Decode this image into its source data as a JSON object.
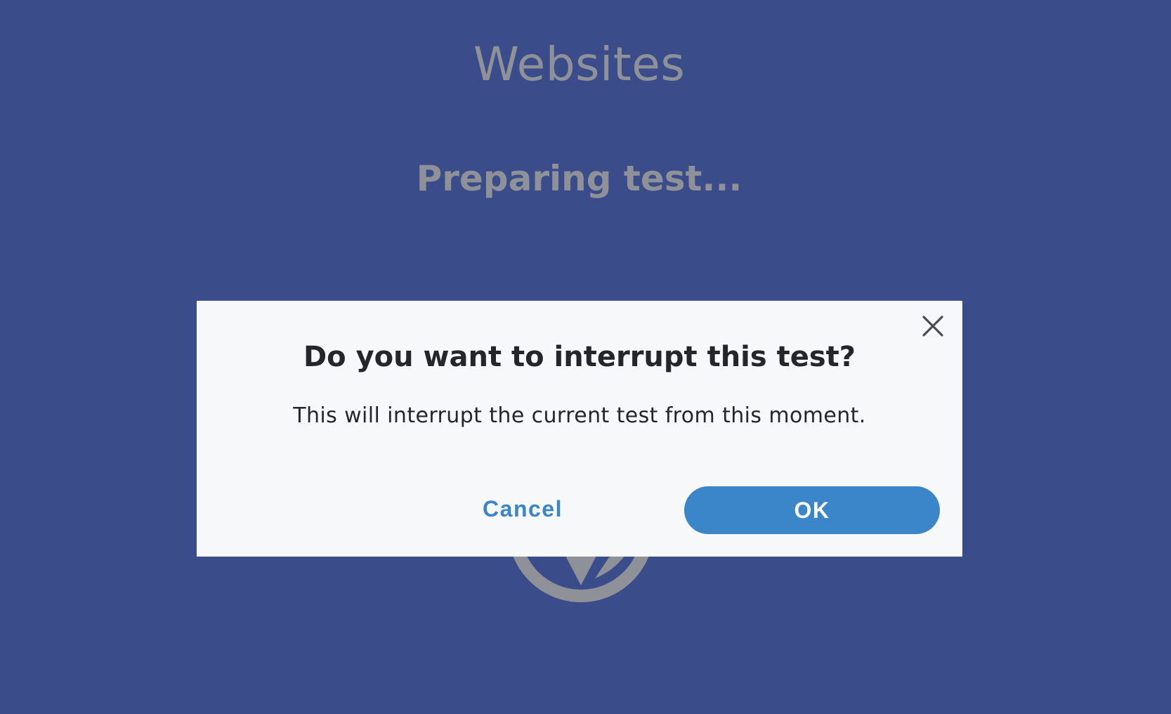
{
  "page": {
    "title": "Websites",
    "status": "Preparing test..."
  },
  "background": {
    "color": "#3a4c8a",
    "logo_icon": "globe-logo-icon",
    "logo_color": "#8f9198"
  },
  "modal": {
    "title": "Do you want to interrupt this test?",
    "message": "This will interrupt the current test from this moment.",
    "cancel_label": "Cancel",
    "ok_label": "OK",
    "close_icon": "close-icon",
    "accent_color": "#3a86c8",
    "background_color": "#f6f8fa"
  }
}
